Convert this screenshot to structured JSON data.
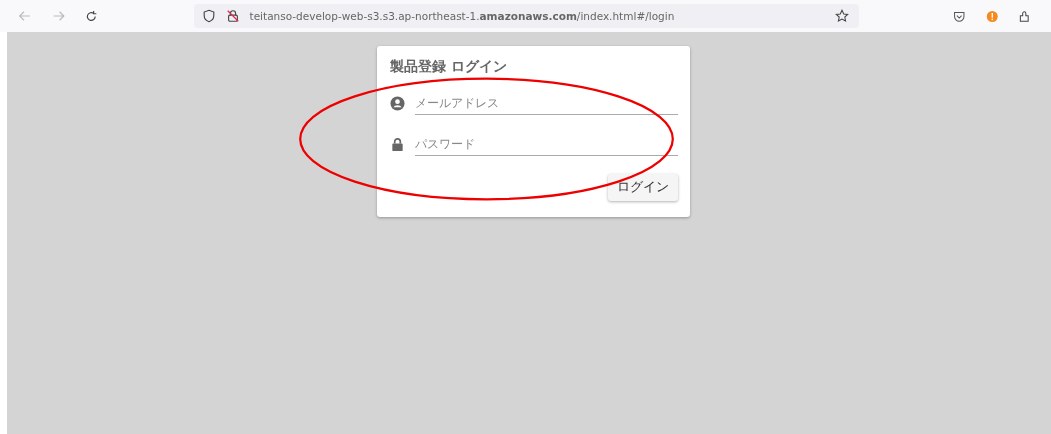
{
  "browser": {
    "url": "teitanso-develop-web-s3.s3.ap-northeast-1.**amazonaws.com**/index.html#/login"
  },
  "login": {
    "title": "製品登録 ログイン",
    "fields": [
      {
        "kind": "email",
        "placeholder": "メールアドレス"
      },
      {
        "kind": "password",
        "placeholder": "パスワード"
      }
    ],
    "button": "ログイン"
  }
}
